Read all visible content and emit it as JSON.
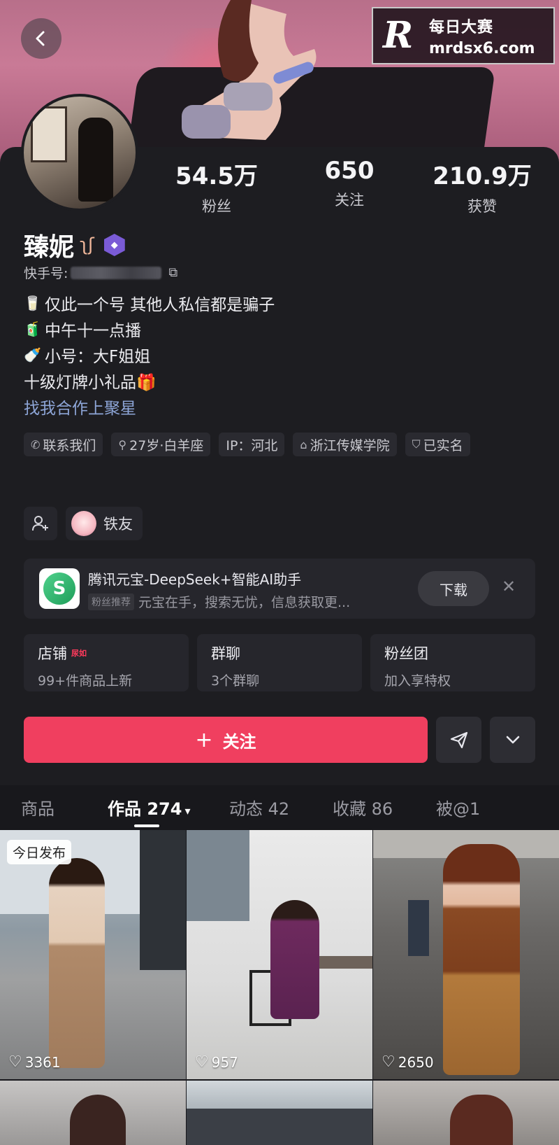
{
  "watermark": {
    "logo": "R",
    "title": "每日大赛",
    "url": "mrdsx6.com"
  },
  "profile": {
    "stats": [
      {
        "value": "54.5万",
        "label": "粉丝"
      },
      {
        "value": "650",
        "label": "关注"
      },
      {
        "value": "210.9万",
        "label": "获赞"
      }
    ],
    "name": "臻妮",
    "uid_label": "快手号:",
    "bio": [
      {
        "icon": "🥛",
        "text": "仅此一个号 其他人私信都是骗子"
      },
      {
        "icon": "🧃",
        "text": "中午十一点播"
      },
      {
        "icon": "🍼",
        "text": "小号：大F姐姐"
      },
      {
        "icon": "",
        "text": "十级灯牌小礼品🎁"
      }
    ],
    "link": "找我合作上聚星",
    "tags": [
      {
        "icon": "phone-icon",
        "text": "联系我们"
      },
      {
        "icon": "gender-icon",
        "text": "27岁·白羊座"
      },
      {
        "icon": "",
        "text": "IP：河北"
      },
      {
        "icon": "school-icon",
        "text": "浙江传媒学院"
      },
      {
        "icon": "shield-icon",
        "text": "已实名"
      }
    ],
    "friend_label": "铁友"
  },
  "ad": {
    "title": "腾讯元宝-DeepSeek+智能AI助手",
    "badge": "粉丝推荐",
    "subtitle": "元宝在手，搜索无忧，信息获取更...",
    "button": "下载"
  },
  "features": [
    {
      "title": "店铺",
      "hot": "尿如",
      "sub": "99+件商品上新"
    },
    {
      "title": "群聊",
      "hot": "",
      "sub": "3个群聊"
    },
    {
      "title": "粉丝团",
      "hot": "",
      "sub": "加入享特权"
    }
  ],
  "actions": {
    "follow": "关注"
  },
  "tabs": [
    {
      "label": "商品"
    },
    {
      "label": "作品 274"
    },
    {
      "label": "动态 42"
    },
    {
      "label": "收藏 86"
    },
    {
      "label": "被@1"
    }
  ],
  "posts": [
    {
      "likes": "3361",
      "badge": "今日发布"
    },
    {
      "likes": "957"
    },
    {
      "likes": "2650"
    }
  ]
}
